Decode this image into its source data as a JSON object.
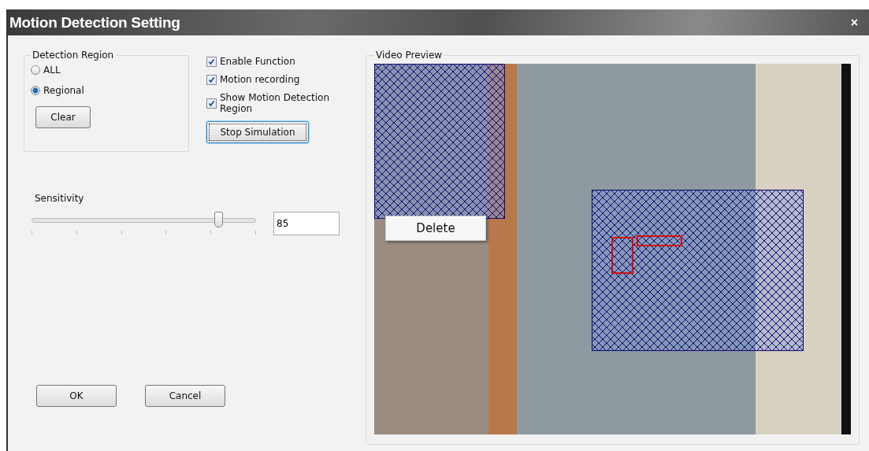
{
  "window": {
    "title": "Motion Detection Setting",
    "close": "×"
  },
  "detection_region": {
    "title": "Detection Region",
    "options": [
      {
        "label": "ALL",
        "selected": false
      },
      {
        "label": "Regional",
        "selected": true
      }
    ],
    "clear_button": "Clear"
  },
  "checkboxes": [
    {
      "label": "Enable Function",
      "checked": true
    },
    {
      "label": "Motion recording",
      "checked": true
    },
    {
      "label": "Show Motion Detection Region",
      "checked": true
    }
  ],
  "simulation_button": "Stop Simulation",
  "sensitivity": {
    "label": "Sensitivity",
    "level": 0.83,
    "value": "85"
  },
  "buttons": [
    "OK",
    "Cancel"
  ],
  "video_preview": {
    "title": "Video Preview",
    "context_menu": [
      "Delete"
    ]
  }
}
